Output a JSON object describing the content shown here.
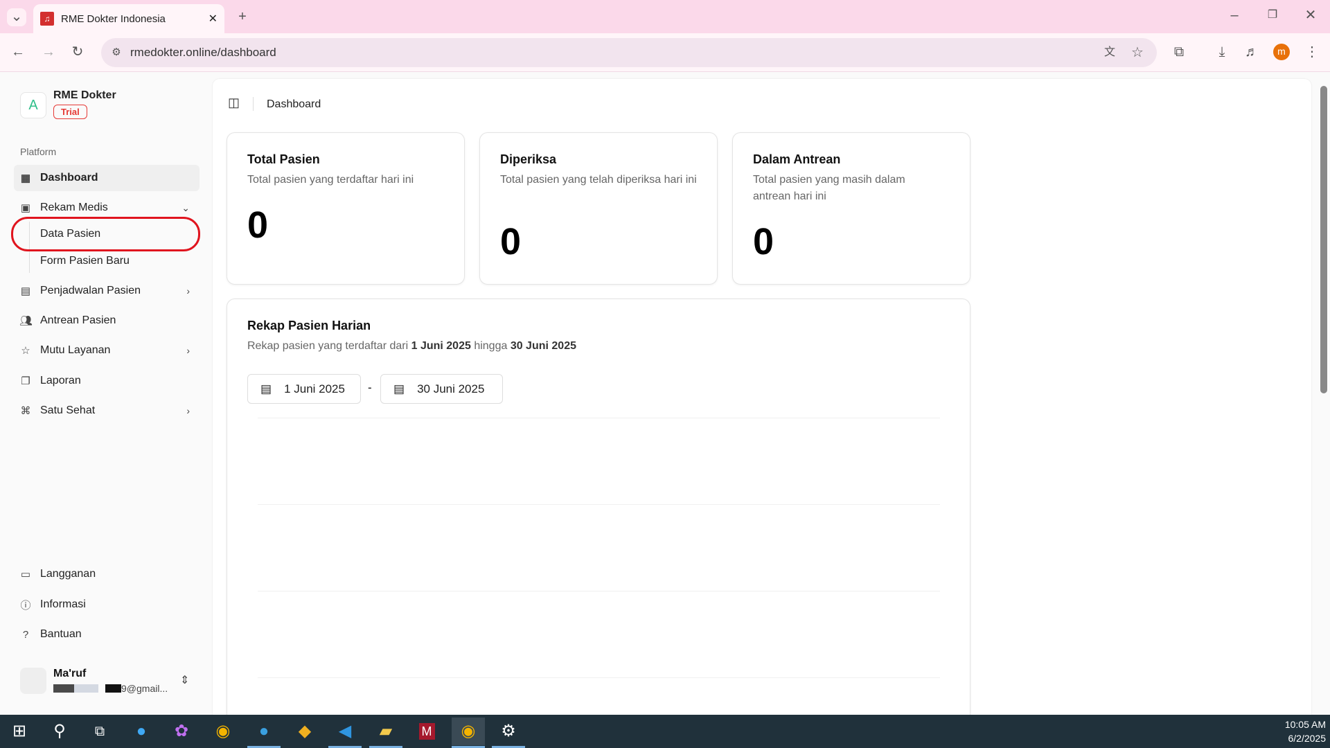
{
  "browser": {
    "tab_title": "RME Dokter Indonesia",
    "url": "rmedokter.online/dashboard",
    "profile_initial": "m"
  },
  "sidebar": {
    "brand": "RME Dokter",
    "badge": "Trial",
    "group": "Platform",
    "items": [
      {
        "label": "Dashboard"
      },
      {
        "label": "Rekam Medis"
      },
      {
        "label": "Penjadwalan Pasien"
      },
      {
        "label": "Antrean Pasien"
      },
      {
        "label": "Mutu Layanan"
      },
      {
        "label": "Laporan"
      },
      {
        "label": "Satu Sehat"
      }
    ],
    "subitems": [
      {
        "label": "Data Pasien"
      },
      {
        "label": "Form Pasien Baru"
      }
    ],
    "bottom": [
      {
        "label": "Langganan"
      },
      {
        "label": "Informasi"
      },
      {
        "label": "Bantuan"
      }
    ],
    "user": {
      "name": "Ma'ruf",
      "email": "9@gmail..."
    }
  },
  "header": {
    "breadcrumb": "Dashboard"
  },
  "cards": [
    {
      "title": "Total Pasien",
      "desc": "Total pasien yang terdaftar hari ini",
      "value": "0"
    },
    {
      "title": "Diperiksa",
      "desc": "Total pasien yang telah diperiksa hari ini",
      "value": "0"
    },
    {
      "title": "Dalam Antrean",
      "desc": "Total pasien yang masih dalam antrean hari ini",
      "value": "0"
    }
  ],
  "rekap": {
    "title": "Rekap Pasien Harian",
    "desc_prefix": "Rekap pasien yang terdaftar dari ",
    "start": "1 Juni 2025",
    "mid": " hingga ",
    "end": "30 Juni 2025",
    "sep": "-"
  },
  "taskbar": {
    "time": "10:05 AM",
    "date": "6/2/2025"
  }
}
